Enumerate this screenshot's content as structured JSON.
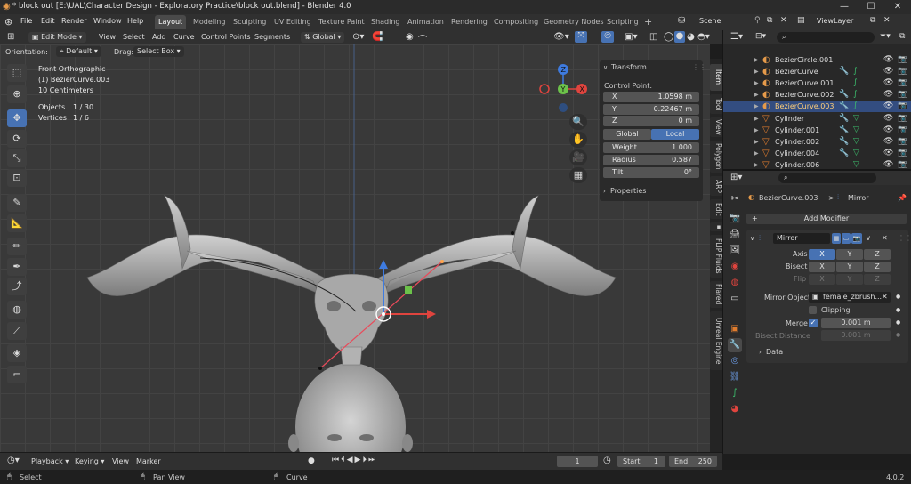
{
  "window": {
    "title": "* block out [E:\\UAL\\Character Design - Exploratory Practice\\block out.blend] - Blender 4.0",
    "minimize": "—",
    "maximize": "☐",
    "close": "✕"
  },
  "menu": [
    "File",
    "Edit",
    "Render",
    "Window",
    "Help"
  ],
  "workspaces": {
    "tabs": [
      "Layout",
      "Modeling",
      "Sculpting",
      "UV Editing",
      "Texture Paint",
      "Shading",
      "Animation",
      "Rendering",
      "Compositing",
      "Geometry Nodes",
      "Scripting"
    ],
    "active": "Layout",
    "add": "+"
  },
  "scene": {
    "label": "Scene",
    "view_layer": "ViewLayer"
  },
  "viewport_header": {
    "mode": "Edit Mode",
    "menus": [
      "View",
      "Select",
      "Add",
      "Curve",
      "Control Points",
      "Segments"
    ],
    "transform_orientation": "Global"
  },
  "tool_settings": {
    "orientation_label": "Orientation:",
    "orientation_value": "Default",
    "drag_label": "Drag:",
    "drag_value": "Select Box"
  },
  "overlay_info": {
    "view_name": "Front Orthographic",
    "object_name": "(1) BezierCurve.003",
    "scale": "10 Centimeters",
    "objects_label": "Objects",
    "objects_value": "1 / 30",
    "vertices_label": "Vertices",
    "vertices_value": "1 / 6"
  },
  "gizmo": {
    "z": "Z",
    "y": "Y",
    "x": "X"
  },
  "transform_panel": {
    "title": "Transform",
    "control_point_label": "Control Point:",
    "x_label": "X",
    "x_value": "1.0598 m",
    "y_label": "Y",
    "y_value": "0.22467 m",
    "z_label": "Z",
    "z_value": "0 m",
    "global_label": "Global",
    "local_label": "Local",
    "weight_label": "Weight",
    "weight_value": "1.000",
    "radius_label": "Radius",
    "radius_value": "0.587",
    "tilt_label": "Tilt",
    "tilt_value": "0°",
    "properties_label": "Properties"
  },
  "side_tabs": [
    "Item",
    "Tool",
    "View",
    "Polygon",
    "ARP",
    "Edit",
    "FLIP Fluids",
    "Flared",
    "Unreal Engine"
  ],
  "outliner": {
    "items": [
      {
        "name": "BezierCircle.001",
        "type": "curve",
        "selected": false
      },
      {
        "name": "BezierCurve",
        "type": "curve",
        "selected": false
      },
      {
        "name": "BezierCurve.001",
        "type": "curve",
        "selected": false
      },
      {
        "name": "BezierCurve.002",
        "type": "curve",
        "selected": false
      },
      {
        "name": "BezierCurve.003",
        "type": "curve",
        "selected": true
      },
      {
        "name": "Cylinder",
        "type": "mesh",
        "selected": false
      },
      {
        "name": "Cylinder.001",
        "type": "mesh",
        "selected": false
      },
      {
        "name": "Cylinder.002",
        "type": "mesh",
        "selected": false
      },
      {
        "name": "Cylinder.004",
        "type": "mesh",
        "selected": false
      },
      {
        "name": "Cylinder.006",
        "type": "mesh",
        "selected": false
      }
    ]
  },
  "properties": {
    "breadcrumb_object": "BezierCurve.003",
    "breadcrumb_sep": ">",
    "breadcrumb_modifier": "Mirror",
    "add_modifier": "Add Modifier",
    "modifier_name": "Mirror",
    "axis_label": "Axis",
    "bisect_label": "Bisect",
    "flip_label": "Flip",
    "x": "X",
    "y": "Y",
    "z": "Z",
    "mirror_object_label": "Mirror Object",
    "mirror_object_value": "female_zbrush...",
    "clipping_label": "Clipping",
    "merge_label": "Merge",
    "merge_value": "0.001 m",
    "bisect_distance_label": "Bisect Distance",
    "bisect_distance_value": "0.001 m",
    "data_label": "Data"
  },
  "timeline": {
    "playback": "Playback",
    "keying": "Keying",
    "view": "View",
    "marker": "Marker",
    "current_frame": "1",
    "start_label": "Start",
    "start_value": "1",
    "end_label": "End",
    "end_value": "250"
  },
  "status_bar": {
    "select": "Select",
    "pan_view": "Pan View",
    "curve": "Curve",
    "version": "4.0.2"
  },
  "colors": {
    "accent_blue": "#4772b3",
    "selection": "#334d80",
    "curve_orange": "#e59a4a",
    "mesh_orange": "#e07c2e",
    "modifier_blue": "#6d9ee8",
    "green_data": "#3cbf6d",
    "axis_red": "#e0443e",
    "axis_green": "#6cc24a",
    "axis_blue": "#3e7be0"
  }
}
